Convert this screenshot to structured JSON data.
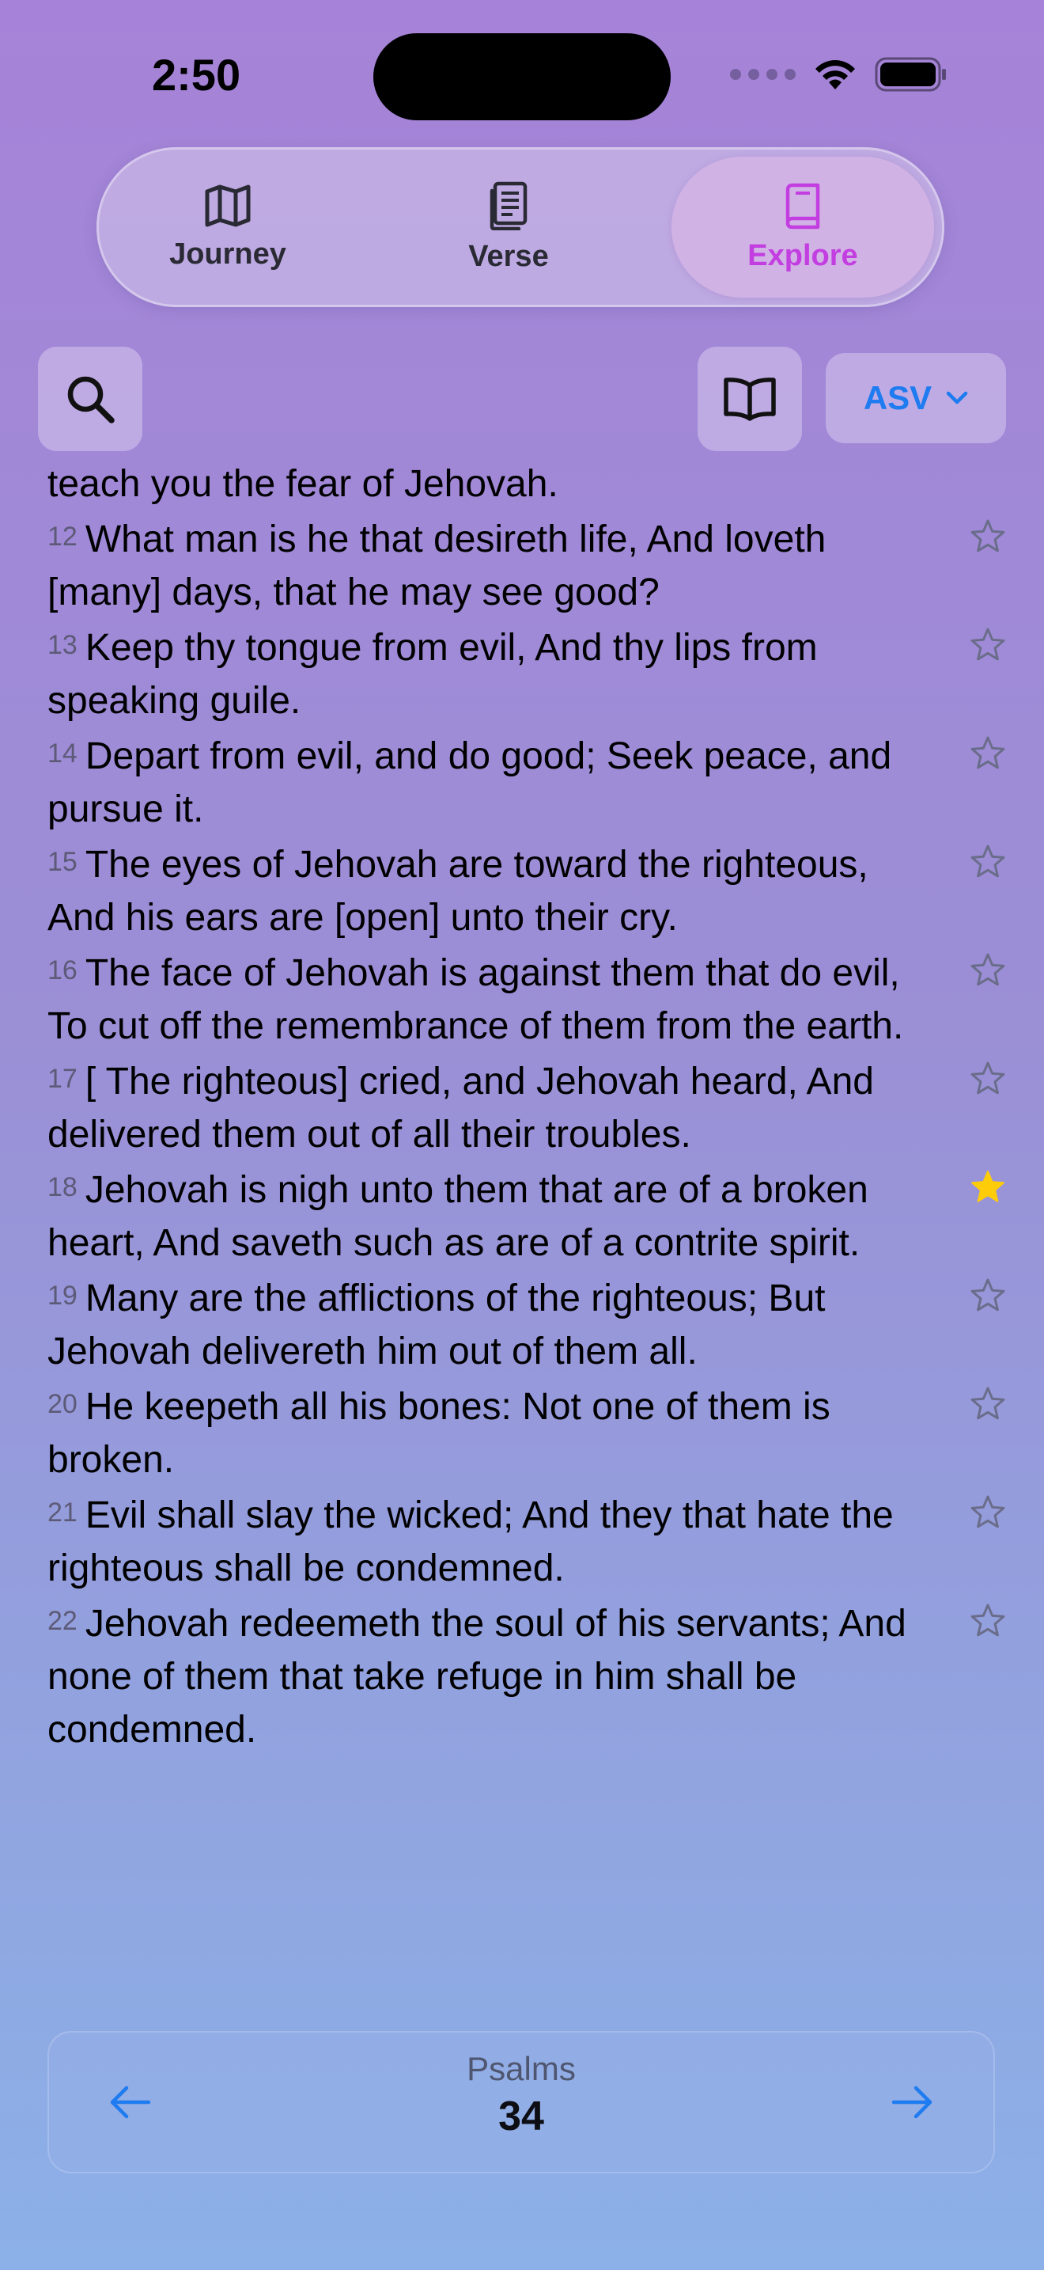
{
  "status_bar": {
    "time": "2:50"
  },
  "tabs": [
    {
      "label": "Journey",
      "icon": "map-icon",
      "active": false
    },
    {
      "label": "Verse",
      "icon": "document-icon",
      "active": false
    },
    {
      "label": "Explore",
      "icon": "book-icon",
      "active": true
    }
  ],
  "toolbar": {
    "version_label": "ASV"
  },
  "reader": {
    "top_fragment": "teach you the fear of Jehovah.",
    "verses": [
      {
        "number": "12",
        "text": "What man is he that desireth life, And loveth [many] days, that he may see good?",
        "starred": false
      },
      {
        "number": "13",
        "text": "Keep thy tongue from evil, And thy lips from speaking guile.",
        "starred": false
      },
      {
        "number": "14",
        "text": "Depart from evil, and do good; Seek peace, and pursue it.",
        "starred": false
      },
      {
        "number": "15",
        "text": "The eyes of Jehovah are toward the righteous, And his ears are [open] unto their cry.",
        "starred": false
      },
      {
        "number": "16",
        "text": "The face of Jehovah is against them that do evil, To cut off the remembrance of them from the earth.",
        "starred": false
      },
      {
        "number": "17",
        "text": "[ The righteous] cried, and Jehovah heard, And delivered them out of all their troubles.",
        "starred": false
      },
      {
        "number": "18",
        "text": "Jehovah is nigh unto them that are of a broken heart, And saveth such as are of a contrite spirit.",
        "starred": true
      },
      {
        "number": "19",
        "text": "Many are the afflictions of the righteous; But Jehovah delivereth him out of them all.",
        "starred": false
      },
      {
        "number": "20",
        "text": "He keepeth all his bones: Not one of them is broken.",
        "starred": false
      },
      {
        "number": "21",
        "text": "Evil shall slay the wicked; And they that hate the righteous shall be condemned.",
        "starred": false
      },
      {
        "number": "22",
        "text": "Jehovah redeemeth the soul of his servants; And none of them that take refuge in him shall be condemned.",
        "starred": false
      }
    ]
  },
  "chapter_nav": {
    "book": "Psalms",
    "chapter": "34"
  },
  "colors": {
    "accent_blue": "#1e7bf0",
    "active_tab": "#c23ee0",
    "star_filled": "#ffcc0a",
    "star_outline": "#6a6d8a"
  }
}
